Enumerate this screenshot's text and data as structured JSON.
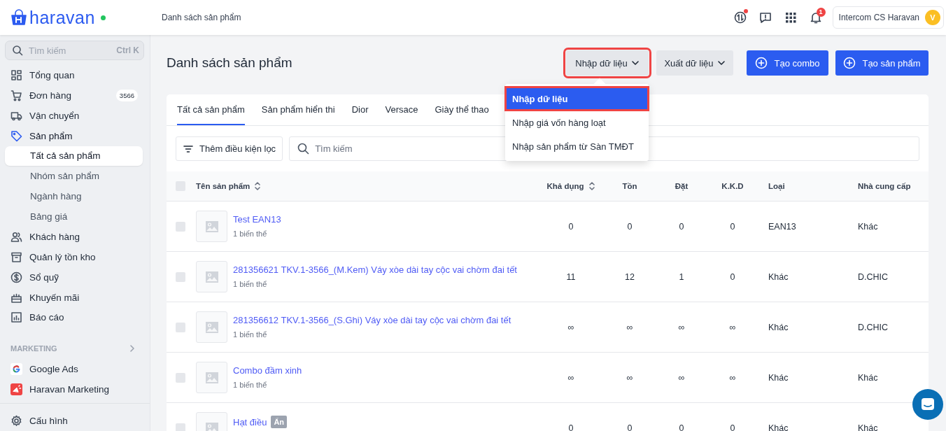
{
  "topbar": {
    "logo_text": "haravan",
    "online": true,
    "breadcrumb": "Danh sách sản phẩm",
    "sync_alert": true,
    "notifications": "1",
    "user": {
      "name": "Intercom CS Haravan",
      "initial": "V"
    }
  },
  "sidebar": {
    "search": {
      "placeholder": "Tìm kiếm",
      "shortcut": "Ctrl K"
    },
    "items": [
      {
        "label": "Tổng quan",
        "selected": false
      },
      {
        "label": "Đơn hàng",
        "badge": "3566",
        "selected": false
      },
      {
        "label": "Vận chuyển",
        "selected": false
      },
      {
        "label": "Sản phẩm",
        "selected": true,
        "expanded": true,
        "children": [
          {
            "label": "Tất cả sản phẩm",
            "selected": true
          },
          {
            "label": "Nhóm sản phẩm",
            "selected": false
          },
          {
            "label": "Ngành hàng",
            "selected": false
          },
          {
            "label": "Bảng giá",
            "selected": false
          }
        ]
      },
      {
        "label": "Khách hàng",
        "selected": false
      },
      {
        "label": "Quản lý tồn kho",
        "selected": false
      },
      {
        "label": "Sổ quỹ",
        "selected": false
      },
      {
        "label": "Khuyến mãi",
        "selected": false
      },
      {
        "label": "Báo cáo",
        "selected": false
      }
    ],
    "section": {
      "title": "MARKETING",
      "items": [
        {
          "label": "Google Ads"
        },
        {
          "label": "Haravan Marketing"
        }
      ]
    },
    "footer_items": [
      {
        "label": "Cấu hình"
      }
    ]
  },
  "page": {
    "title": "Danh sách sản phẩm",
    "actions": [
      {
        "label": "Nhập dữ liệu",
        "kind": "dropdown",
        "highlighted": true
      },
      {
        "label": "Xuất dữ liệu",
        "kind": "dropdown",
        "highlighted": false
      },
      {
        "label": "Tạo combo",
        "kind": "primary",
        "highlighted": false
      },
      {
        "label": "Tạo sản phẩm",
        "kind": "primary",
        "highlighted": false
      }
    ],
    "dropdown": {
      "items": [
        {
          "label": "Nhập dữ liệu",
          "selected": true,
          "highlighted": true
        },
        {
          "label": "Nhập giá vốn hàng loạt",
          "selected": false,
          "highlighted": false
        },
        {
          "label": "Nhập sản phẩm từ Sàn TMĐT",
          "selected": false,
          "highlighted": false
        }
      ]
    }
  },
  "tabs": [
    {
      "label": "Tất cả sản phẩm",
      "selected": true
    },
    {
      "label": "Sản phẩm hiển thi",
      "selected": false
    },
    {
      "label": "Dior",
      "selected": false
    },
    {
      "label": "Versace",
      "selected": false
    },
    {
      "label": "Giày thể thao",
      "selected": false
    }
  ],
  "filter": {
    "button": "Thêm điều kiện lọc",
    "search_placeholder": "Tìm kiếm"
  },
  "table": {
    "select_all": false,
    "columns": [
      {
        "label": "Tên sản phẩm",
        "sortable": true
      },
      {
        "label": "Khả dụng",
        "sortable": true
      },
      {
        "label": "Tồn",
        "sortable": false
      },
      {
        "label": "Đặt",
        "sortable": false
      },
      {
        "label": "K.K.D",
        "sortable": false
      },
      {
        "label": "Loại",
        "sortable": false
      },
      {
        "label": "Nhà cung cấp",
        "sortable": false
      }
    ],
    "rows": [
      {
        "checked": false,
        "variants": "1 biến thể",
        "cells": [
          "Test EAN13",
          "0",
          "0",
          "0",
          "0",
          "EAN13",
          "Khác"
        ]
      },
      {
        "checked": false,
        "variants": "1 biến thể",
        "cells": [
          "281356621 TKV.1-3566_(M.Kem) Váy xòe dài tay cộc vai chờm đai tết",
          "11",
          "12",
          "1",
          "0",
          "Khác",
          "D.CHIC"
        ]
      },
      {
        "checked": false,
        "variants": "1 biến thể",
        "cells": [
          "281356612 TKV.1-3566_(S.Ghi) Váy xòe dài tay cộc vai chờm đai tết",
          "∞",
          "∞",
          "∞",
          "∞",
          "Khác",
          "D.CHIC"
        ]
      },
      {
        "checked": false,
        "variants": "1 biến thể",
        "cells": [
          "Combo đầm xinh",
          "∞",
          "∞",
          "∞",
          "∞",
          "Khác",
          "Khác"
        ]
      },
      {
        "checked": false,
        "badge": "Ẩn",
        "cells": [
          "Hạt điều",
          "0",
          "0",
          "0",
          "0",
          "Khác",
          "Khác"
        ]
      }
    ]
  }
}
